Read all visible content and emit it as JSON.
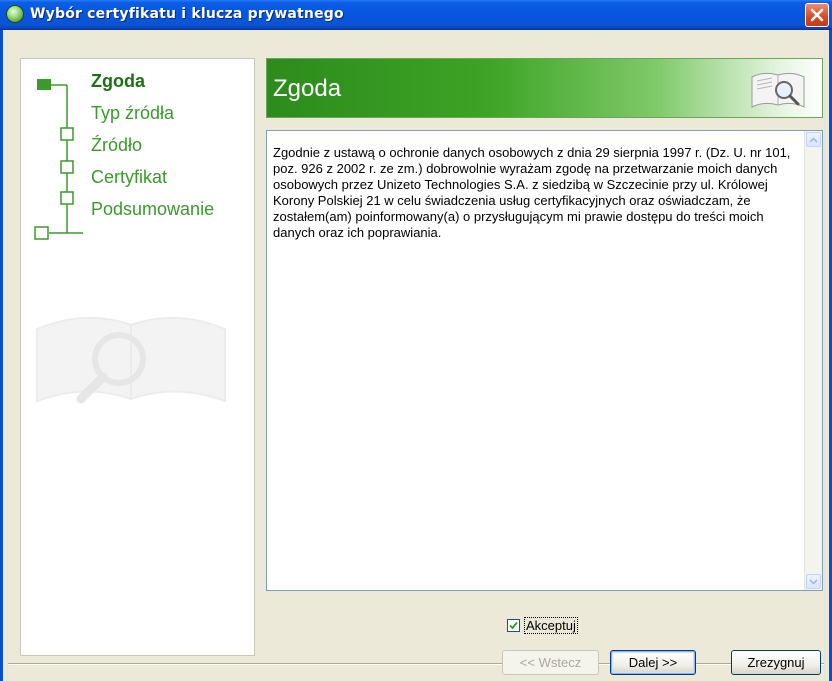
{
  "window": {
    "title": "Wybór certyfikatu i klucza prywatnego"
  },
  "steps": [
    {
      "label": "Zgoda",
      "active": true
    },
    {
      "label": "Typ źródła",
      "active": false
    },
    {
      "label": "Źródło",
      "active": false
    },
    {
      "label": "Certyfikat",
      "active": false
    },
    {
      "label": "Podsumowanie",
      "active": false
    }
  ],
  "banner": {
    "title": "Zgoda",
    "icon": "book-magnifier-icon"
  },
  "consent": {
    "text": "Zgodnie z ustawą o ochronie danych osobowych z dnia 29 sierpnia 1997 r. (Dz. U. nr 101, poz. 926 z 2002 r. ze zm.) dobrowolnie wyrażam zgodę na przetwarzanie moich danych osobowych przez Unizeto Technologies S.A. z siedzibą w Szczecinie przy ul. Królowej Korony Polskiej 21 w celu świadczenia usług certyfikacyjnych oraz oświadczam, że zostałem(am) poinformowany(a) o przysługującym mi prawie dostępu do treści moich danych oraz ich poprawiania."
  },
  "accept": {
    "label": "Akceptuj",
    "checked": true
  },
  "buttons": {
    "back": "<< Wstecz",
    "next": "Dalej >>",
    "cancel": "Zrezygnuj"
  },
  "colors": {
    "titlebar": "#0755e0",
    "accent_green": "#3da426",
    "step_text": "#3a9a2c"
  }
}
